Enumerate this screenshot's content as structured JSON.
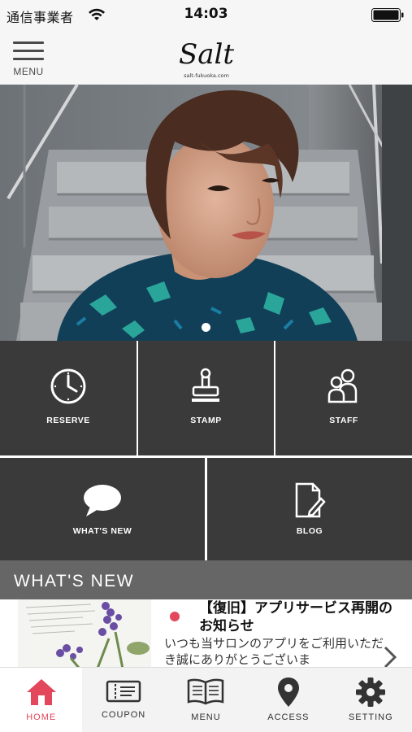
{
  "status_bar": {
    "carrier": "通信事業者",
    "time": "14:03"
  },
  "header": {
    "menu_label": "MENU",
    "brand_name": "Salt",
    "brand_domain": "salt-fukuoka.com"
  },
  "hero": {
    "slide_count": 1,
    "active_slide": 1
  },
  "tiles": [
    {
      "label": "RESERVE",
      "icon": "clock-icon"
    },
    {
      "label": "STAMP",
      "icon": "stamp-icon"
    },
    {
      "label": "STAFF",
      "icon": "staff-icon"
    },
    {
      "label": "WHAT'S NEW",
      "icon": "speech-bubble-icon"
    },
    {
      "label": "BLOG",
      "icon": "document-pen-icon"
    }
  ],
  "whats_new": {
    "title": "WHAT'S NEW",
    "items": [
      {
        "headline": "【復旧】アプリサービス再開のお知らせ",
        "excerpt": "いつも当サロンのアプリをご利用いただき誠にありがとうございま"
      }
    ]
  },
  "tabbar": {
    "active": "HOME",
    "active_color": "#e2475b",
    "items": [
      {
        "label": "HOME",
        "icon": "home-icon"
      },
      {
        "label": "COUPON",
        "icon": "coupon-icon"
      },
      {
        "label": "MENU",
        "icon": "book-icon"
      },
      {
        "label": "ACCESS",
        "icon": "map-pin-icon"
      },
      {
        "label": "SETTING",
        "icon": "gear-icon"
      }
    ]
  },
  "colors": {
    "tile_background": "#3a3a3a",
    "news_header_background": "#666666",
    "accent": "#e2475b"
  }
}
